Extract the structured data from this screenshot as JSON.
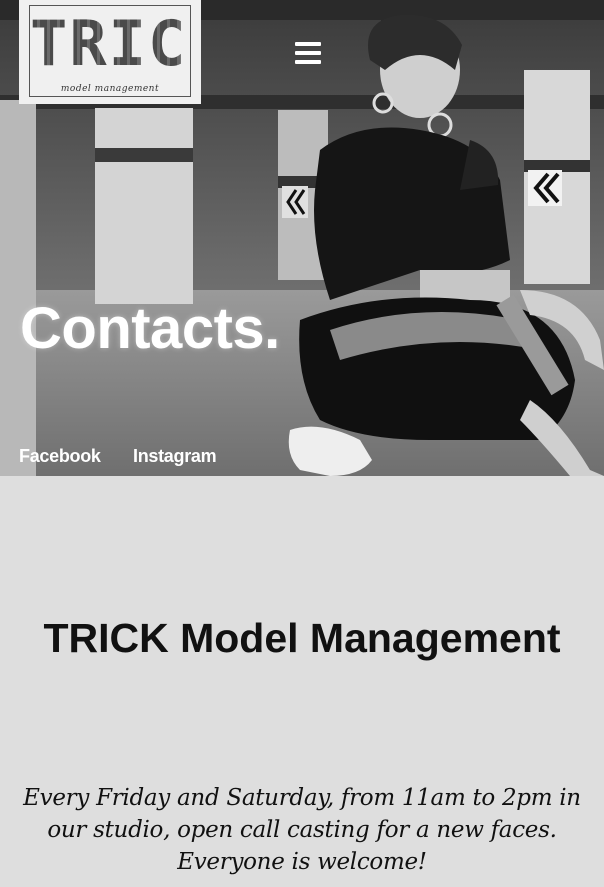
{
  "header": {
    "logo_text": "TRICK",
    "logo_subtitle": "model management",
    "menu_icon": "hamburger-menu-icon"
  },
  "hero": {
    "title": "Contacts.",
    "social_links": [
      {
        "label": "Facebook"
      },
      {
        "label": "Instagram"
      }
    ]
  },
  "content": {
    "company_name": "TRICK Model Management",
    "intro": "Every Friday and Saturday, from 11am to 2pm in our studio, open call casting for a new faces. Everyone is welcome!"
  },
  "colors": {
    "overlay_text": "#ffffff",
    "content_background": "#dedede",
    "body_text": "#111111"
  }
}
